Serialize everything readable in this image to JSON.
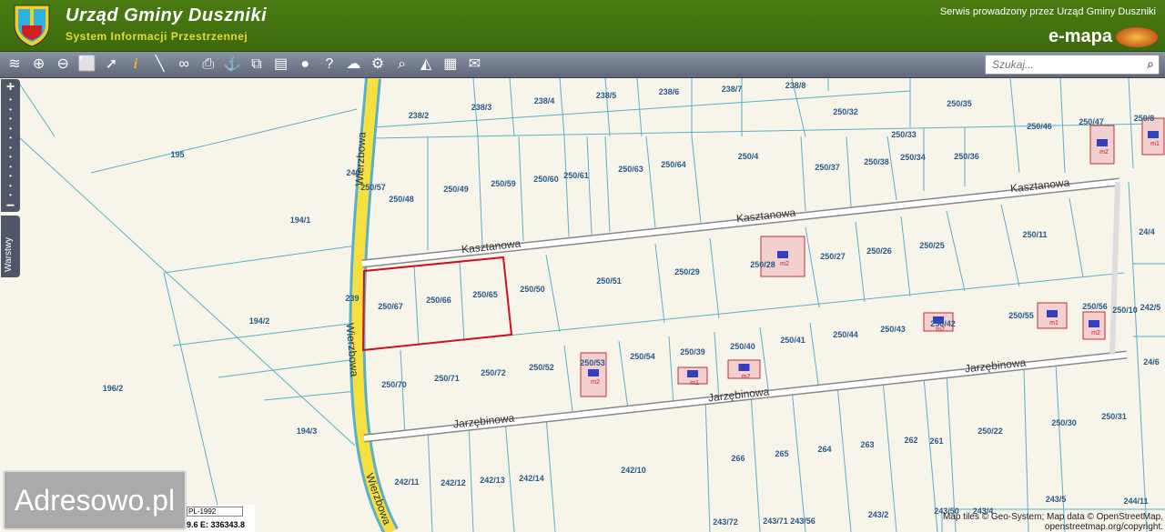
{
  "header": {
    "title": "Urząd Gminy Duszniki",
    "subtitle": "System Informacji Przestrzennej",
    "service": "Serwis prowadzony przez Urząd Gminy Duszniki",
    "brand": "e-mapa"
  },
  "toolbar": {
    "tools": [
      "layers-icon",
      "zoom-in-icon",
      "zoom-out-icon",
      "full-extent-icon",
      "pointer-icon",
      "info-icon",
      "measure-icon",
      "link-icon",
      "print-icon",
      "download-icon",
      "compare-icon",
      "layout-icon",
      "comment-icon",
      "help-icon",
      "cloud-icon",
      "settings-icon",
      "search-map-icon",
      "triangle-icon",
      "color-palette-icon",
      "user-comment-icon"
    ],
    "search_placeholder": "Szukaj..."
  },
  "side": {
    "zoom_in": "+",
    "zoom_out": "−",
    "layers_label": "Warstwy"
  },
  "map": {
    "streets": {
      "kasztanowa": "Kasztanowa",
      "jarzebinowa": "Jarzębinowa",
      "wierzbowa": "Wierzbowa"
    },
    "parcels": [
      "238/2",
      "238/3",
      "238/4",
      "238/5",
      "238/6",
      "238/7",
      "238/8",
      "250/32",
      "250/35",
      "250/46",
      "250/47",
      "250/8",
      "195",
      "240",
      "250/57",
      "250/48",
      "250/49",
      "250/59",
      "250/60",
      "250/61",
      "250/63",
      "250/64",
      "250/4",
      "250/37",
      "250/38",
      "250/33",
      "250/34",
      "250/36",
      "194/1",
      "250/11",
      "250/28",
      "250/27",
      "250/26",
      "250/25",
      "24/4",
      "194/2",
      "239",
      "250/67",
      "250/66",
      "250/65",
      "250/50",
      "250/51",
      "250/29",
      "250/42",
      "250/43",
      "250/44",
      "250/41",
      "250/40",
      "250/39",
      "250/54",
      "250/53",
      "250/52",
      "250/55",
      "250/56",
      "250/10",
      "242/5",
      "250/70",
      "250/71",
      "250/72",
      "24/6",
      "196/2",
      "194/3",
      "250/22",
      "250/30",
      "250/31",
      "266",
      "265",
      "264",
      "263",
      "262",
      "261",
      "242/11",
      "242/12",
      "242/13",
      "242/14",
      "242/10",
      "243/2",
      "243/72",
      "243/71",
      "243/56",
      "243/50",
      "243/4",
      "243/5",
      "244/11"
    ],
    "buildings": [
      "m2",
      "m2",
      "m1",
      "m2",
      "m2",
      "m1",
      "m2",
      "m2",
      "m1"
    ]
  },
  "footer": {
    "watermark": "Adresowo.pl",
    "crs": "PL-1992",
    "coord": "9.6   E: 336343.8",
    "attribution_line1": "Map tiles © Geo-System; Map data © OpenStreetMap,",
    "attribution_line2": "openstreetmap.org/copyright."
  },
  "colors": {
    "header": "#3d6a0c",
    "toolbar": "#6b7484",
    "parcel_line": "#5ab0c8",
    "selection": "#d01020",
    "road_yellow": "#f5e040"
  }
}
